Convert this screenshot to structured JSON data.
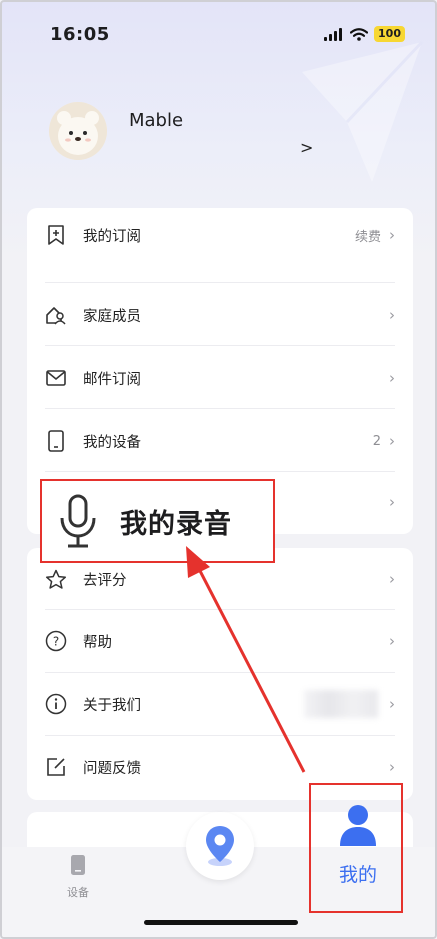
{
  "status_bar": {
    "time": "16:05",
    "battery": "100"
  },
  "profile": {
    "name": "Mable",
    "chevron": ">"
  },
  "menu_group1": [
    {
      "label": "我的订阅",
      "right_text": "续费",
      "icon": "bookmark-plus-icon"
    },
    {
      "label": "家庭成员",
      "right_text": "",
      "icon": "family-icon"
    },
    {
      "label": "邮件订阅",
      "right_text": "",
      "icon": "mail-icon"
    },
    {
      "label": "我的设备",
      "right_text": "2",
      "icon": "device-icon"
    },
    {
      "label": "",
      "right_text": "",
      "icon": ""
    }
  ],
  "menu_group2": [
    {
      "label": "去评分",
      "icon": "star-icon"
    },
    {
      "label": "帮助",
      "icon": "help-icon"
    },
    {
      "label": "关于我们",
      "icon": "info-icon"
    },
    {
      "label": "问题反馈",
      "icon": "feedback-icon"
    }
  ],
  "annotation": {
    "label": "我的录音",
    "icon": "microphone-icon",
    "accent": "#e5322d"
  },
  "tabbar": {
    "device_label": "设备",
    "mine_label": "我的",
    "active_color": "#3c6ff0"
  }
}
